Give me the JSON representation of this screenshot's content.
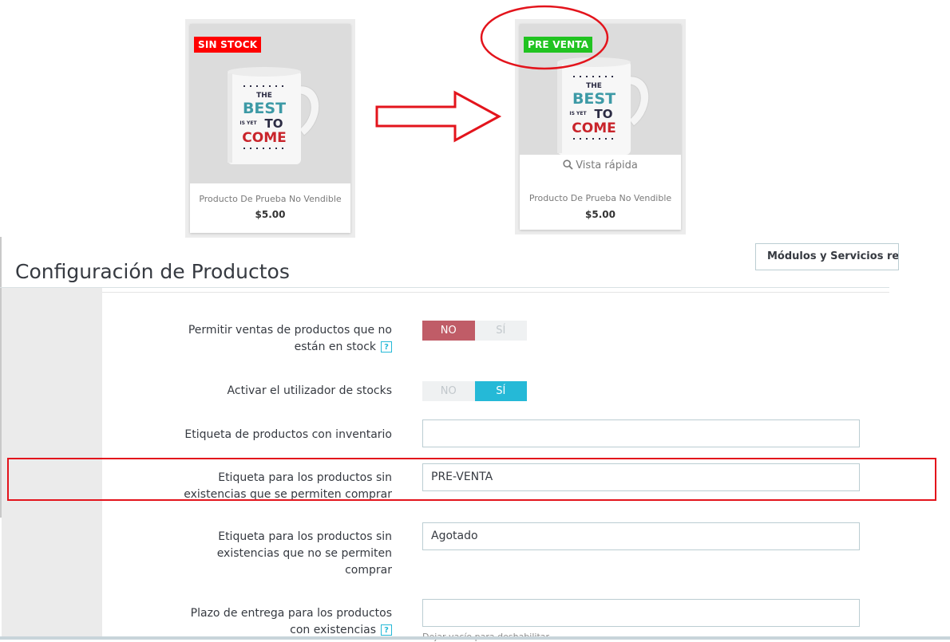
{
  "product_cards": {
    "left": {
      "badge": "SIN STOCK",
      "name": "Producto De Prueba No Vendible",
      "price": "$5.00"
    },
    "right": {
      "badge": "PRE VENTA",
      "quick_view": "Vista rápida",
      "name": "Producto De Prueba No Vendible",
      "price": "$5.00"
    }
  },
  "mug_text": [
    "THE",
    "BEST",
    "IS YET",
    "TO",
    "COME"
  ],
  "header": {
    "title": "Configuración de Productos",
    "modules_button": "Módulos y Servicios rec"
  },
  "form": {
    "allow_oos_sales": {
      "label_line1": "Permitir ventas de productos que no",
      "label_line2": "están en stock",
      "help": "?",
      "options": [
        "NO",
        "SÍ"
      ],
      "selected": "NO"
    },
    "stock_manager": {
      "label": "Activar el utilizador de stocks",
      "options": [
        "NO",
        "SÍ"
      ],
      "selected": "SÍ"
    },
    "in_stock_label": {
      "label": "Etiqueta de productos con inventario",
      "value": ""
    },
    "oos_allowed_label": {
      "label_line1": "Etiqueta para los productos sin",
      "label_line2": "existencias que se permiten comprar",
      "value": "PRE-VENTA"
    },
    "oos_denied_label": {
      "label_line1": "Etiqueta para los productos sin",
      "label_line2": "existencias que no se permiten",
      "label_line3": "comprar",
      "value": "Agotado"
    },
    "delivery_time": {
      "label_line1": "Plazo de entrega para los productos",
      "label_line2": "con existencias",
      "help": "?",
      "value": "",
      "hint": "Dejar vacío para deshabilitar"
    }
  },
  "colors": {
    "sin_stock_badge": "#ff0000",
    "pre_venta_badge": "#21c321",
    "switch_no_active": "#c05c67",
    "switch_si_active": "#25b9d7",
    "annotation_red": "#e3141c"
  }
}
